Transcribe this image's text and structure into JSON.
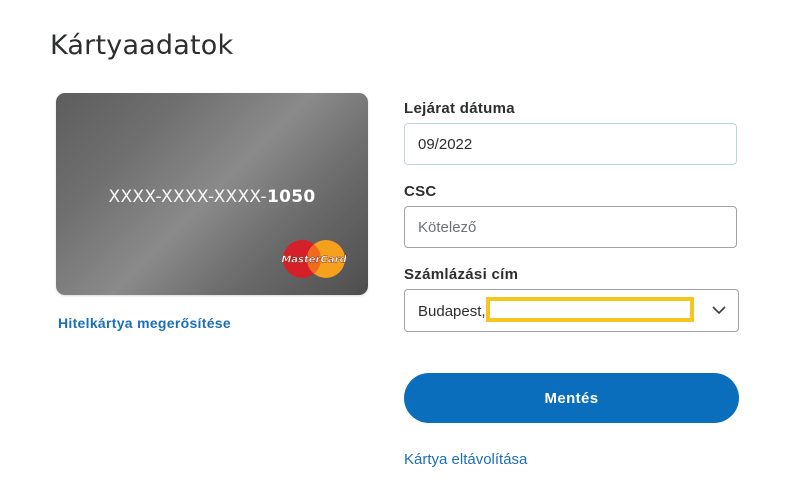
{
  "page": {
    "title": "Kártyaadatok"
  },
  "card": {
    "number_mask": "XXXX-XXXX-XXXX-",
    "last4": "1050",
    "brand_logo_text": "MasterCard",
    "brand_icon": "mastercard-logo",
    "confirm_link": "Hitelkártya megerősítése"
  },
  "form": {
    "expiry": {
      "label": "Lejárat dátuma",
      "value": "09/2022"
    },
    "csc": {
      "label": "CSC",
      "placeholder": "Kötelező",
      "value": ""
    },
    "billing": {
      "label": "Számlázási cím",
      "value": "Budapest,",
      "chevron_icon": "chevron-down-icon"
    },
    "save_label": "Mentés",
    "remove_link": "Kártya eltávolítása"
  },
  "colors": {
    "accent": "#0a6ebd",
    "link": "#1c6fb5",
    "highlight": "#f6c51e"
  }
}
